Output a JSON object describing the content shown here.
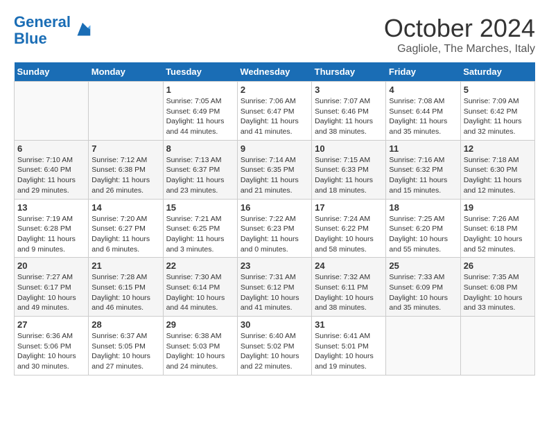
{
  "header": {
    "logo_line1": "General",
    "logo_line2": "Blue",
    "month": "October 2024",
    "location": "Gagliole, The Marches, Italy"
  },
  "days_of_week": [
    "Sunday",
    "Monday",
    "Tuesday",
    "Wednesday",
    "Thursday",
    "Friday",
    "Saturday"
  ],
  "weeks": [
    [
      {
        "day": "",
        "info": ""
      },
      {
        "day": "",
        "info": ""
      },
      {
        "day": "1",
        "info": "Sunrise: 7:05 AM\nSunset: 6:49 PM\nDaylight: 11 hours and 44 minutes."
      },
      {
        "day": "2",
        "info": "Sunrise: 7:06 AM\nSunset: 6:47 PM\nDaylight: 11 hours and 41 minutes."
      },
      {
        "day": "3",
        "info": "Sunrise: 7:07 AM\nSunset: 6:46 PM\nDaylight: 11 hours and 38 minutes."
      },
      {
        "day": "4",
        "info": "Sunrise: 7:08 AM\nSunset: 6:44 PM\nDaylight: 11 hours and 35 minutes."
      },
      {
        "day": "5",
        "info": "Sunrise: 7:09 AM\nSunset: 6:42 PM\nDaylight: 11 hours and 32 minutes."
      }
    ],
    [
      {
        "day": "6",
        "info": "Sunrise: 7:10 AM\nSunset: 6:40 PM\nDaylight: 11 hours and 29 minutes."
      },
      {
        "day": "7",
        "info": "Sunrise: 7:12 AM\nSunset: 6:38 PM\nDaylight: 11 hours and 26 minutes."
      },
      {
        "day": "8",
        "info": "Sunrise: 7:13 AM\nSunset: 6:37 PM\nDaylight: 11 hours and 23 minutes."
      },
      {
        "day": "9",
        "info": "Sunrise: 7:14 AM\nSunset: 6:35 PM\nDaylight: 11 hours and 21 minutes."
      },
      {
        "day": "10",
        "info": "Sunrise: 7:15 AM\nSunset: 6:33 PM\nDaylight: 11 hours and 18 minutes."
      },
      {
        "day": "11",
        "info": "Sunrise: 7:16 AM\nSunset: 6:32 PM\nDaylight: 11 hours and 15 minutes."
      },
      {
        "day": "12",
        "info": "Sunrise: 7:18 AM\nSunset: 6:30 PM\nDaylight: 11 hours and 12 minutes."
      }
    ],
    [
      {
        "day": "13",
        "info": "Sunrise: 7:19 AM\nSunset: 6:28 PM\nDaylight: 11 hours and 9 minutes."
      },
      {
        "day": "14",
        "info": "Sunrise: 7:20 AM\nSunset: 6:27 PM\nDaylight: 11 hours and 6 minutes."
      },
      {
        "day": "15",
        "info": "Sunrise: 7:21 AM\nSunset: 6:25 PM\nDaylight: 11 hours and 3 minutes."
      },
      {
        "day": "16",
        "info": "Sunrise: 7:22 AM\nSunset: 6:23 PM\nDaylight: 11 hours and 0 minutes."
      },
      {
        "day": "17",
        "info": "Sunrise: 7:24 AM\nSunset: 6:22 PM\nDaylight: 10 hours and 58 minutes."
      },
      {
        "day": "18",
        "info": "Sunrise: 7:25 AM\nSunset: 6:20 PM\nDaylight: 10 hours and 55 minutes."
      },
      {
        "day": "19",
        "info": "Sunrise: 7:26 AM\nSunset: 6:18 PM\nDaylight: 10 hours and 52 minutes."
      }
    ],
    [
      {
        "day": "20",
        "info": "Sunrise: 7:27 AM\nSunset: 6:17 PM\nDaylight: 10 hours and 49 minutes."
      },
      {
        "day": "21",
        "info": "Sunrise: 7:28 AM\nSunset: 6:15 PM\nDaylight: 10 hours and 46 minutes."
      },
      {
        "day": "22",
        "info": "Sunrise: 7:30 AM\nSunset: 6:14 PM\nDaylight: 10 hours and 44 minutes."
      },
      {
        "day": "23",
        "info": "Sunrise: 7:31 AM\nSunset: 6:12 PM\nDaylight: 10 hours and 41 minutes."
      },
      {
        "day": "24",
        "info": "Sunrise: 7:32 AM\nSunset: 6:11 PM\nDaylight: 10 hours and 38 minutes."
      },
      {
        "day": "25",
        "info": "Sunrise: 7:33 AM\nSunset: 6:09 PM\nDaylight: 10 hours and 35 minutes."
      },
      {
        "day": "26",
        "info": "Sunrise: 7:35 AM\nSunset: 6:08 PM\nDaylight: 10 hours and 33 minutes."
      }
    ],
    [
      {
        "day": "27",
        "info": "Sunrise: 6:36 AM\nSunset: 5:06 PM\nDaylight: 10 hours and 30 minutes."
      },
      {
        "day": "28",
        "info": "Sunrise: 6:37 AM\nSunset: 5:05 PM\nDaylight: 10 hours and 27 minutes."
      },
      {
        "day": "29",
        "info": "Sunrise: 6:38 AM\nSunset: 5:03 PM\nDaylight: 10 hours and 24 minutes."
      },
      {
        "day": "30",
        "info": "Sunrise: 6:40 AM\nSunset: 5:02 PM\nDaylight: 10 hours and 22 minutes."
      },
      {
        "day": "31",
        "info": "Sunrise: 6:41 AM\nSunset: 5:01 PM\nDaylight: 10 hours and 19 minutes."
      },
      {
        "day": "",
        "info": ""
      },
      {
        "day": "",
        "info": ""
      }
    ]
  ]
}
